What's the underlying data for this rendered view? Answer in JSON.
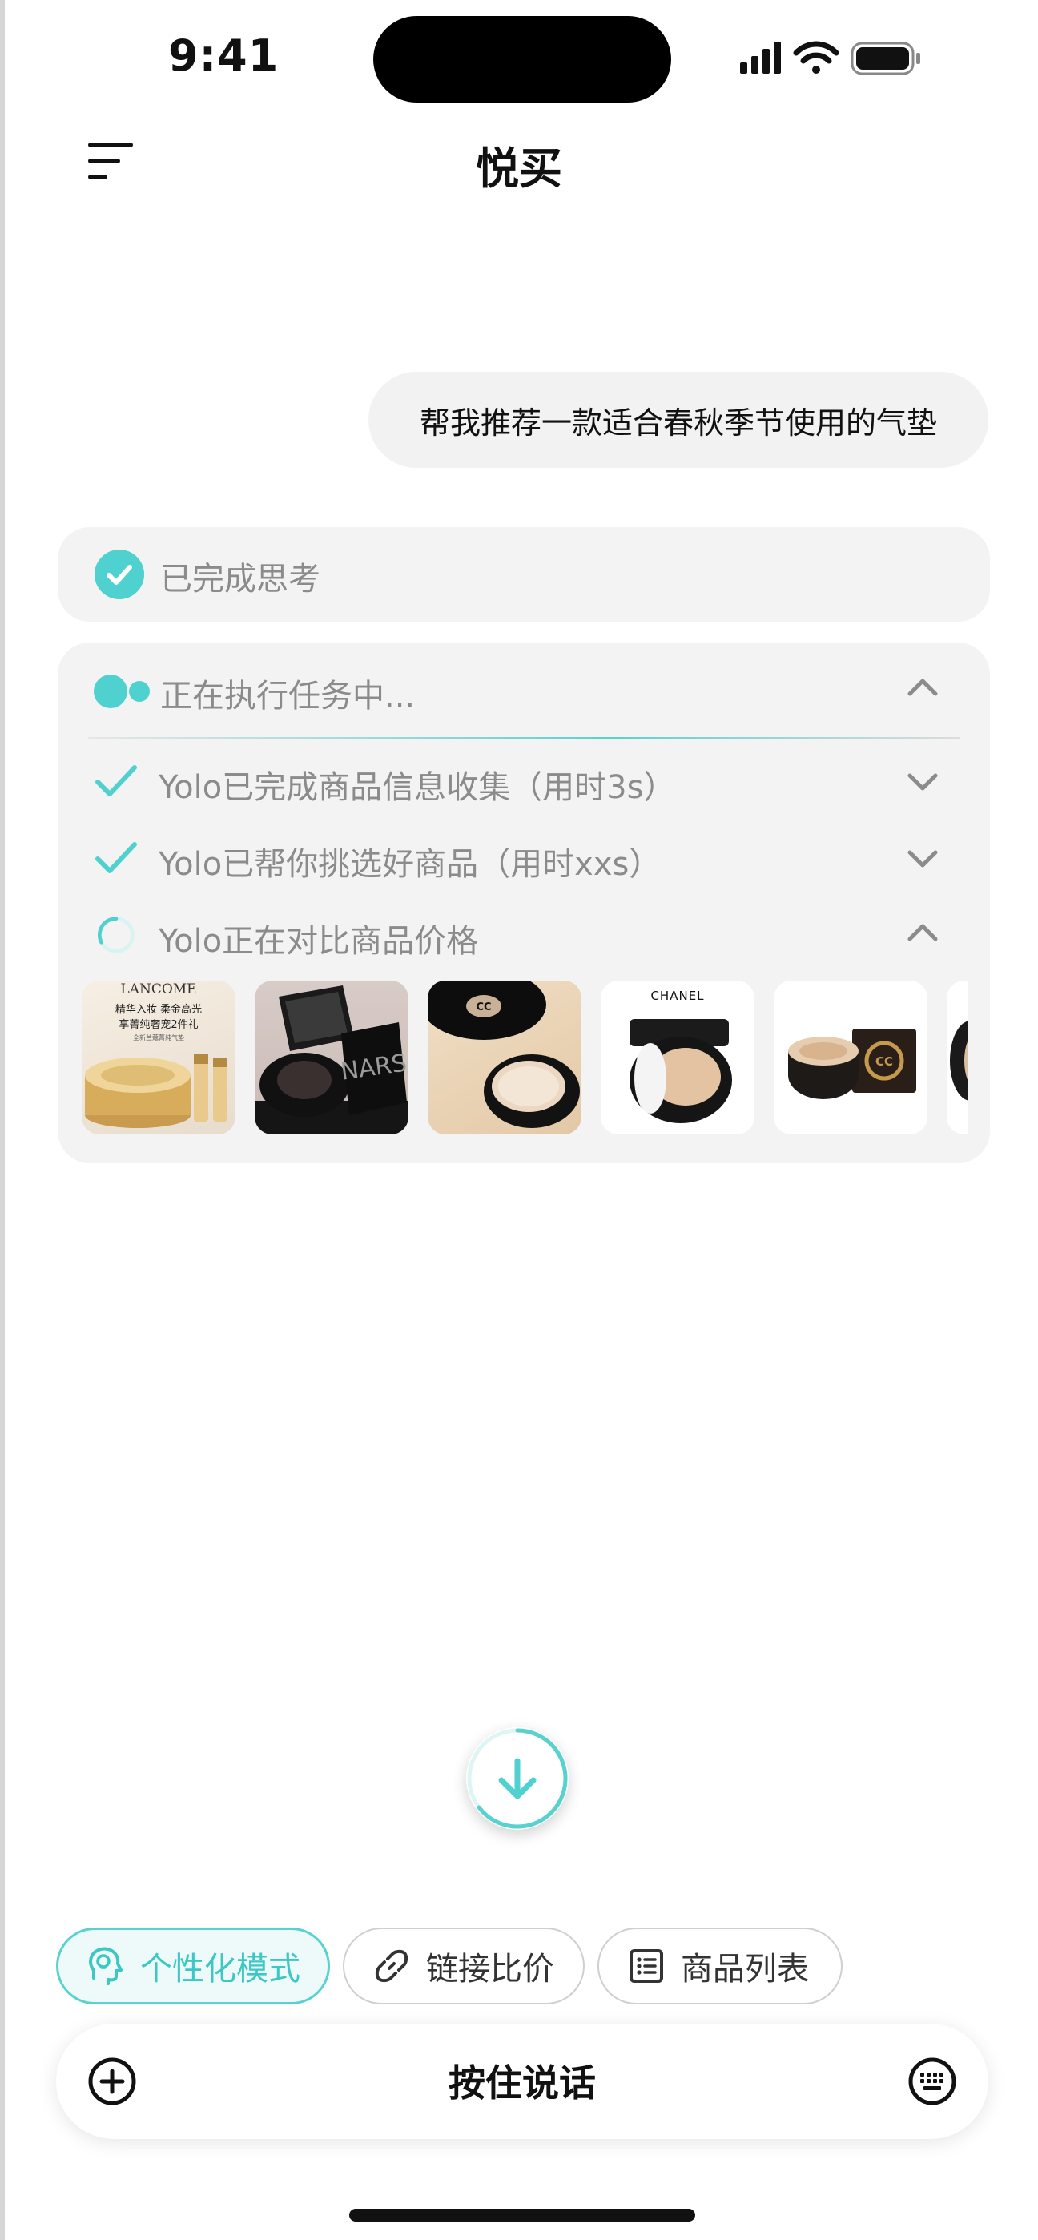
{
  "status_bar": {
    "time": "9:41"
  },
  "header": {
    "title": "悦买"
  },
  "chat": {
    "user_message": "帮我推荐一款适合春秋季节使用的气垫",
    "thinking": {
      "label": "已完成思考"
    },
    "task": {
      "title": "正在执行任务中...",
      "steps": [
        {
          "label": "Yolo已完成商品信息收集（用时3s）",
          "status": "done"
        },
        {
          "label": "Yolo已帮你挑选好商品（用时xxs）",
          "status": "done"
        },
        {
          "label": "Yolo正在对比商品价格",
          "status": "in-progress"
        }
      ],
      "products": [
        {
          "brand": "LANCOME",
          "caption_line1": "精华入妆 柔金高光",
          "caption_line2": "享菁纯奢宠2件礼",
          "caption_line3": "全新兰蔻菁纯气垫"
        },
        {
          "brand": "NARS"
        },
        {
          "brand": "CC"
        },
        {
          "brand": "CHANEL"
        },
        {
          "brand": "CC"
        }
      ]
    }
  },
  "chips": {
    "personalized": "个性化模式",
    "link_compare": "链接比价",
    "product_list": "商品列表"
  },
  "input": {
    "hold_to_talk": "按住说话"
  },
  "colors": {
    "accent": "#4fd1cf",
    "card_bg": "#f3f3f3",
    "muted_text": "#8b8b8b"
  },
  "icons": [
    "menu-icon",
    "check-circle-icon",
    "check-icon",
    "loading-spinner-icon",
    "chevron-up-icon",
    "chevron-down-icon",
    "arrow-down-icon",
    "head-bulb-icon",
    "link-icon",
    "list-icon",
    "plus-circle-icon",
    "keyboard-icon"
  ]
}
